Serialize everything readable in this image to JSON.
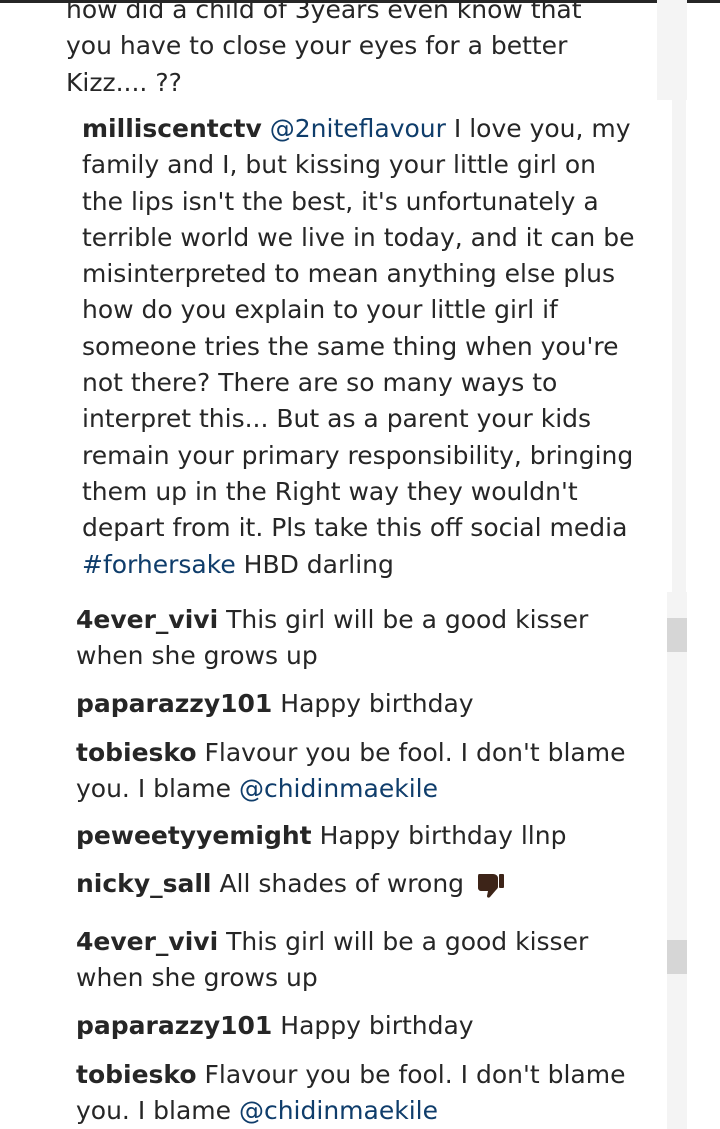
{
  "comments": [
    {
      "username": "",
      "text": "how did a child of 3years even know that you have to close your eyes for a better Kizz.... ??"
    },
    {
      "username": "milliscentctv",
      "mention": "@2niteflavour",
      "text": " I love you, my family and I, but kissing your little girl on the lips isn't the best, it's unfortunately a terrible world we live in today, and it can be misinterpreted to mean anything else plus how do you explain to your little girl if someone tries the same thing when you're not there? There are so many ways to interpret this... But as a parent your kids remain your primary responsibility, bringing them up in the Right way they wouldn't depart from it. Pls take this off social media ",
      "hashtag": "#forhersake",
      "text_after": " HBD darling"
    },
    {
      "username": "4ever_vivi",
      "text": " This girl will be a good kisser when she grows up"
    },
    {
      "username": "paparazzy101",
      "text": " Happy birthday"
    },
    {
      "username": "tobiesko",
      "text": " Flavour you be fool. I don't blame you. I blame ",
      "mention": "@chidinmaekile"
    },
    {
      "username": "peweetyyemight",
      "text": " Happy birthday llnp"
    },
    {
      "username": "nicky_sall",
      "text": " All shades of wrong",
      "icon": "thumbs-down-icon"
    },
    {
      "username": "4ever_vivi",
      "text": " This girl will be a good kisser when she grows up"
    },
    {
      "username": "paparazzy101",
      "text": " Happy birthday"
    },
    {
      "username": "tobiesko",
      "text": " Flavour you be fool. I don't blame you. I blame ",
      "mention": "@chidinmaekile"
    }
  ],
  "colors": {
    "text": "#262626",
    "link": "#0f3d6b",
    "scrollbar_track": "#f4f4f4",
    "scrollbar_thumb": "#d6d6d6"
  }
}
